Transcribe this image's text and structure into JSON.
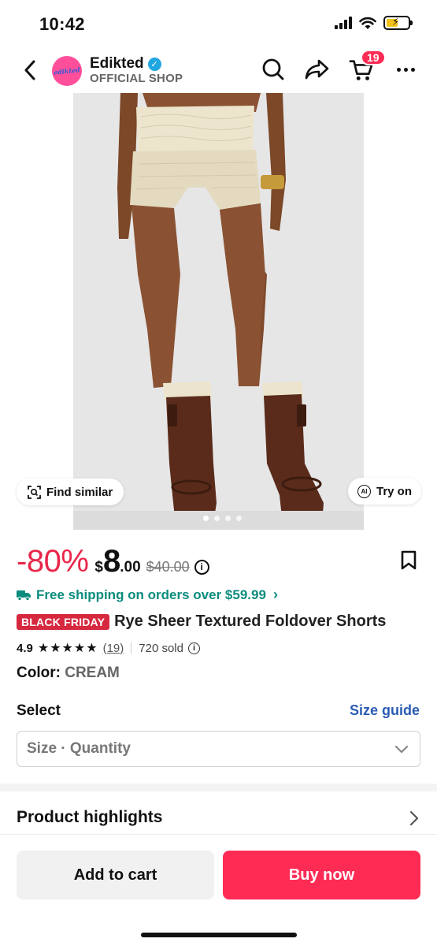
{
  "status_bar": {
    "time": "10:42"
  },
  "header": {
    "shop_name": "Edikted",
    "shop_label": "OFFICIAL SHOP",
    "logo_text": "edikted",
    "cart_count": "19",
    "icons": [
      "back-icon",
      "search-icon",
      "share-icon",
      "cart-icon",
      "more-icon"
    ]
  },
  "gallery": {
    "find_similar_label": "Find similar",
    "try_on_label": "Try on",
    "try_on_icon_text": "AI",
    "image_count": 4,
    "active_index": 0,
    "colors": {
      "skin": "#8a5232",
      "shorts": "#ece4cc",
      "boots": "#5a2b1b",
      "background": "#e5e5e6"
    }
  },
  "price": {
    "discount": "-80%",
    "currency": "$",
    "integer": "8",
    "decimal": ".00",
    "original": "$40.00"
  },
  "shipping": {
    "text": "Free shipping on orders over $59.99"
  },
  "product": {
    "badge": "BLACK FRIDAY",
    "title": "Rye Sheer Textured Foldover Shorts",
    "rating": "4.9",
    "stars": "★★★★★",
    "review_count": "(19)",
    "sold": "720 sold",
    "color_label": "Color:",
    "color_value": "CREAM"
  },
  "select": {
    "label": "Select",
    "size_guide": "Size guide",
    "placeholder": "Size · Quantity"
  },
  "highlights": {
    "label": "Product highlights"
  },
  "actions": {
    "add_to_cart": "Add to cart",
    "buy_now": "Buy now"
  },
  "theme": {
    "accent": "#fe2c55",
    "discount": "#e8274a",
    "shipping": "#0b8c7d",
    "link": "#2a5cb3"
  }
}
